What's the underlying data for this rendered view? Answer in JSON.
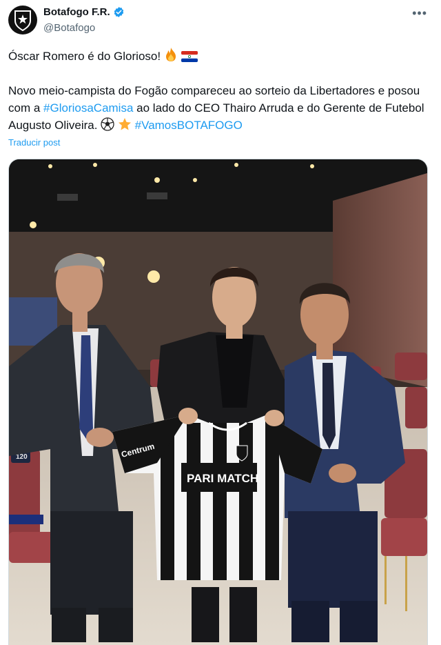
{
  "account": {
    "display_name": "Botafogo F.R.",
    "handle": "@Botafogo",
    "verified": true,
    "avatar_icon": "botafogo-crest-icon"
  },
  "tweet": {
    "line1": "Óscar Romero é do Glorioso!",
    "line1_emojis": [
      "fire-emoji",
      "paraguay-flag-emoji"
    ],
    "para2_part1": "Novo meio-campista do Fogão compareceu ao sorteio da Libertadores e posou com a",
    "hashtag1": "#GloriosaCamisa",
    "para2_part2": "ao lado do CEO Thairo Arruda e do Gerente de Futebol Augusto Oliveira.",
    "para2_emojis": [
      "soccer-ball-emoji",
      "star-emoji"
    ],
    "hashtag2": "#VamosBOTAFOGO"
  },
  "translate_label": "Traducir post",
  "media": {
    "jersey_sponsor": "PARI MATCH",
    "sleeve_sponsor": "Centrum",
    "seat_number": "120"
  },
  "colors": {
    "link": "#1d9bf0",
    "secondary_text": "#536471",
    "border": "#cfd9de"
  }
}
